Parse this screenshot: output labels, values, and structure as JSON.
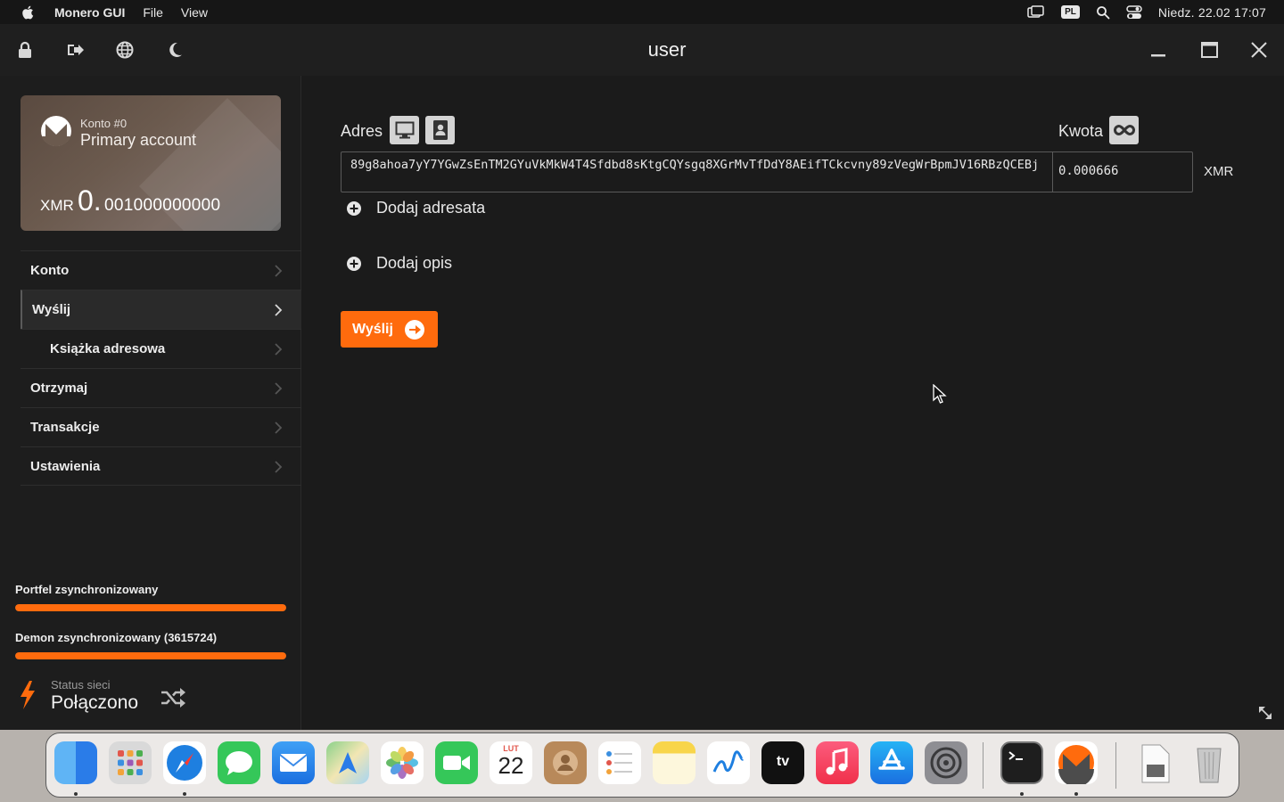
{
  "menubar": {
    "app_name": "Monero GUI",
    "menus": [
      "File",
      "View"
    ],
    "input_source": "PL",
    "datetime": "Niedz. 22.02  17:07"
  },
  "window": {
    "title": "user"
  },
  "account_card": {
    "account_number": "Konto #0",
    "account_name": "Primary account",
    "currency": "XMR",
    "balance_int": "0.",
    "balance_frac": "001000000000"
  },
  "sidebar": {
    "items": [
      {
        "label": "Konto"
      },
      {
        "label": "Wyślij"
      },
      {
        "label": "Książka adresowa"
      },
      {
        "label": "Otrzymaj"
      },
      {
        "label": "Transakcje"
      },
      {
        "label": "Ustawienia"
      }
    ],
    "wallet_sync_label": "Portfel zsynchronizowany",
    "wallet_sync_progress": 1.0,
    "daemon_sync_label": "Demon zsynchronizowany (3615724)",
    "daemon_sync_progress": 1.0,
    "network_status_label": "Status sieci",
    "network_status_value": "Połączono"
  },
  "send": {
    "address_label": "Adres",
    "address_value": "89g8ahoa7yY7YGwZsEnTM2GYuVkMkW4T4Sfdbd8sKtgCQYsgq8XGrMvTfDdY8AEifTCkcvny89zVegWrBpmJV16RBzQCEBj",
    "amount_label": "Kwota",
    "amount_value": "0.000666",
    "amount_currency": "XMR",
    "add_recipient": "Dodaj adresata",
    "add_description": "Dodaj opis",
    "send_button": "Wyślij"
  },
  "colors": {
    "accent": "#ff6b0d",
    "background": "#1b1b1b",
    "sidebar": "#1d1d1d"
  },
  "dock": {
    "apps": [
      "finder",
      "launchpad",
      "safari",
      "messages",
      "mail",
      "maps",
      "photos",
      "facetime",
      "calendar",
      "contacts",
      "reminders",
      "notes",
      "freeform",
      "apple-tv",
      "music",
      "app-store",
      "system-settings",
      "terminal",
      "monero-gui",
      "preview-document",
      "trash"
    ],
    "calendar_month": "LUT",
    "calendar_day": "22",
    "tv_label": "tv"
  }
}
